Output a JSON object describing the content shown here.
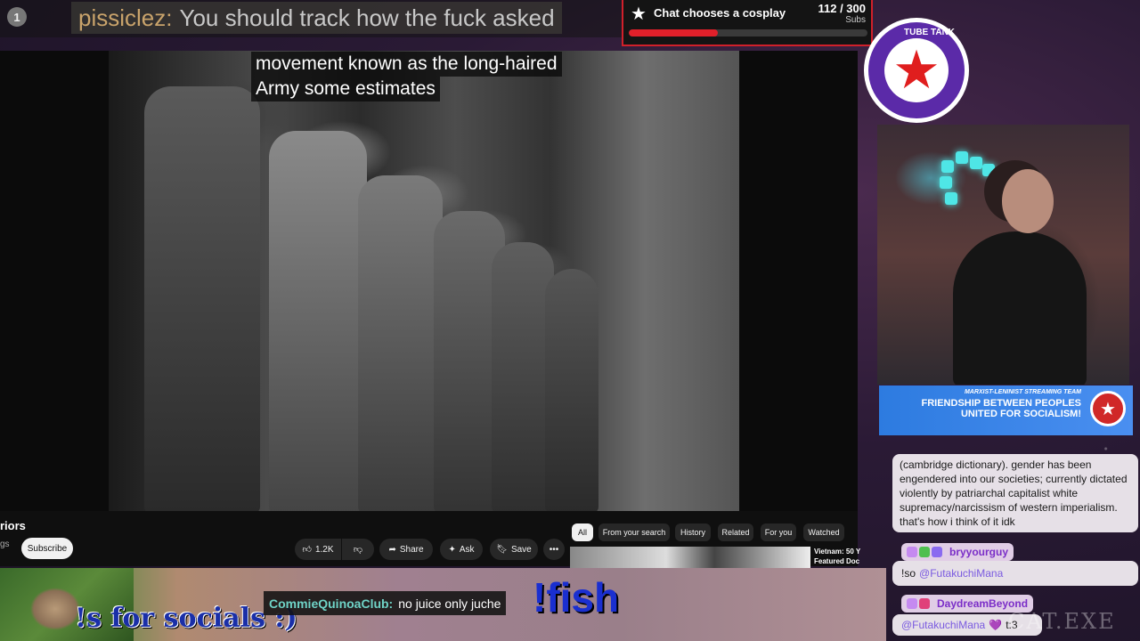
{
  "overlay": {
    "notification_count": "1",
    "top_chat": {
      "user": "pissiclez:",
      "text": "You should track how the fuck asked"
    },
    "goal": {
      "label": "Chat chooses a cosplay",
      "count": "112 / 300",
      "unit": "Subs",
      "progress": 0.373,
      "accent": "#e0202a"
    },
    "caption_lines": [
      "movement known as the long-haired",
      "Army some estimates"
    ],
    "socials_text": "!s for socials :)",
    "bottom_chat": {
      "user": "CommieQuinoaClub:",
      "text": "no juice only juche"
    },
    "fish_command": "!fish",
    "logo_text": "TUBE TANK",
    "team_banner": {
      "small": "MARXIST-LENINIST STREAMING TEAM",
      "line1": "FRIENDSHIP BETWEEN PEOPLES",
      "line2": "UNITED FOR SOCIALISM!"
    },
    "watermark": "CAT.EXE"
  },
  "youtube": {
    "title_fragment": "riors",
    "channel_fragment": "gs",
    "subscribe_label": "Subscribe",
    "like_count": "1.2K",
    "share_label": "Share",
    "ask_label": "Ask",
    "save_label": "Save",
    "more_label": "•••",
    "chips": [
      "All",
      "From your search",
      "History",
      "Related",
      "For you",
      "Watched"
    ],
    "related_title": "Vietnam: 50 Y",
    "related_sub": "Featured Doc"
  },
  "side_chat": {
    "message_text": "(cambridge dictionary). gender has been engendered into our societies; currently dictated violently by patriarchal capitalist white supremacy/narcissism of western imperialism. that's how i think of it idk",
    "users": [
      {
        "name": "bryyourguy",
        "text_prefix": "!so",
        "mention": "@FutakuchiMana",
        "suffix": ""
      },
      {
        "name": "DaydreamBeyond",
        "text_prefix": "",
        "mention": "@FutakuchiMana",
        "suffix": "t:3"
      }
    ]
  }
}
